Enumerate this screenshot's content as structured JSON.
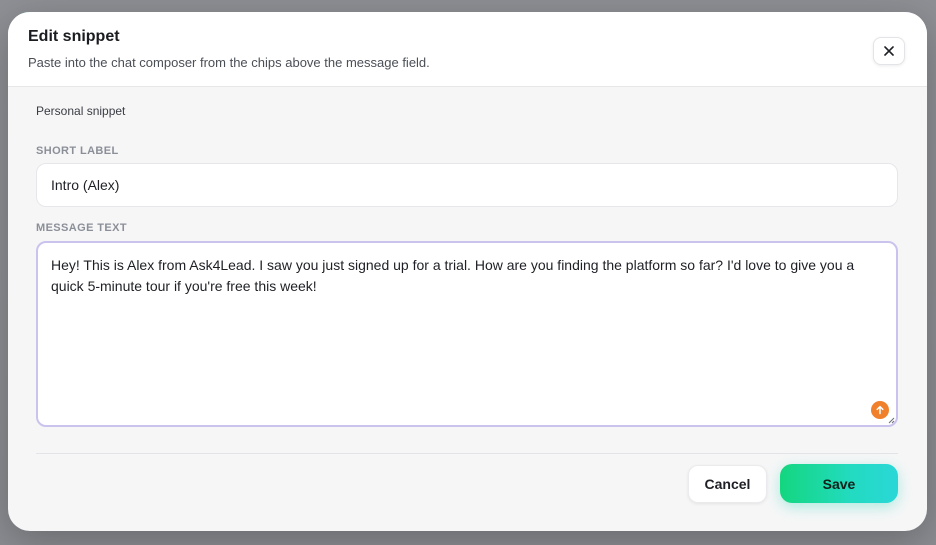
{
  "dialog": {
    "title": "Edit snippet",
    "subtitle": "Paste into the chat composer from the chips above the message field.",
    "close_icon": "close-icon"
  },
  "scope": {
    "label": "Personal snippet"
  },
  "short_label": {
    "label": "SHORT LABEL",
    "value": "Intro (Alex)"
  },
  "message_text": {
    "label": "MESSAGE TEXT",
    "value": "Hey! This is Alex from Ask4Lead. I saw you just signed up for a trial. How are you finding the platform so far? I'd love to give you a quick 5-minute tour if you're free this week!",
    "action_icon": "arrow-up-icon",
    "action_color": "#f0802b"
  },
  "footer": {
    "cancel_label": "Cancel",
    "save_label": "Save"
  },
  "colors": {
    "accent_gradient_start": "#14d67f",
    "accent_gradient_end": "#2ad7d8",
    "focus_border": "#c9c3ee"
  }
}
